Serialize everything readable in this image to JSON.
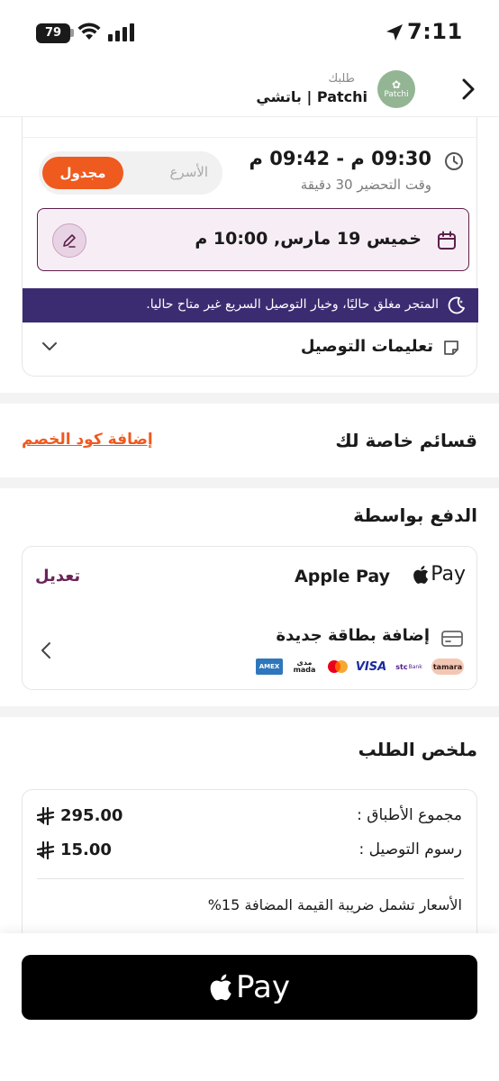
{
  "status_bar": {
    "battery": "79",
    "time": "7:11"
  },
  "header": {
    "subtitle": "طلبك",
    "title": "باتشي | Patchi",
    "logo_text": "Patchi"
  },
  "delivery": {
    "time_range": "09:30 م - 09:42 م",
    "prep_time": "وقت التحضير 30 دقيقة",
    "mode_fast": "الأسرع",
    "mode_scheduled": "مجدول",
    "selected_date": "خميس 19 مارس, 10:00 م",
    "closed_notice": "المتجر مغلق حاليًا، وخيار التوصيل السريع غير متاح حاليا.",
    "instructions_label": "تعليمات التوصيل"
  },
  "lists": {
    "title": "قسائم خاصة لك",
    "coupon_link": "إضافة كود الخصم"
  },
  "payment": {
    "title": "الدفع بواسطة",
    "method_label": "Apple Pay",
    "pay_logo_text": "Pay",
    "edit_label": "تعديل",
    "new_card_label": "إضافة بطاقة جديدة",
    "brands": [
      "tamara",
      "stc Bank",
      "VISA",
      "Mastercard",
      "mada",
      "AMEX"
    ],
    "brand_text": {
      "tamara": "tamara",
      "stc": "stc",
      "stc_sub": "Bank",
      "visa": "VISA",
      "mada_top": "مدى",
      "mada_bottom": "mada",
      "amex": "AMEX"
    }
  },
  "summary": {
    "title": "ملخص الطلب",
    "subtotal_label": "مجموع الأطباق :",
    "subtotal_value": "295.00",
    "delivery_label": "رسوم التوصيل :",
    "delivery_value": "15.00",
    "vat_note": "الأسعار تشمل ضريبة القيمة المضافة 15%"
  },
  "checkout": {
    "button_text": "Pay"
  },
  "colors": {
    "accent_orange": "#ef5a1f",
    "brand_plum": "#6b2458",
    "banner_purple": "#3b2c72",
    "logo_green": "#93b594"
  }
}
